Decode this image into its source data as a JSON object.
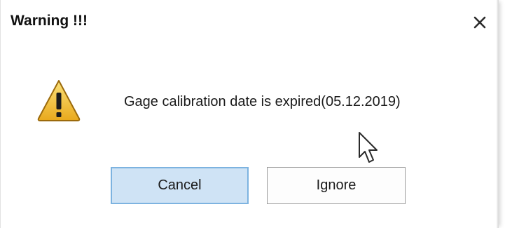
{
  "dialog": {
    "title": "Warning !!!",
    "close_icon": "close-icon",
    "icon": "warning-triangle-icon",
    "message": "Gage calibration date is expired(05.12.2019)",
    "buttons": {
      "cancel_label": "Cancel",
      "ignore_label": "Ignore"
    }
  },
  "colors": {
    "cancel_bg": "#cfe3f5",
    "cancel_border": "#7db3e0",
    "warning_yellow": "#f2c12e"
  }
}
